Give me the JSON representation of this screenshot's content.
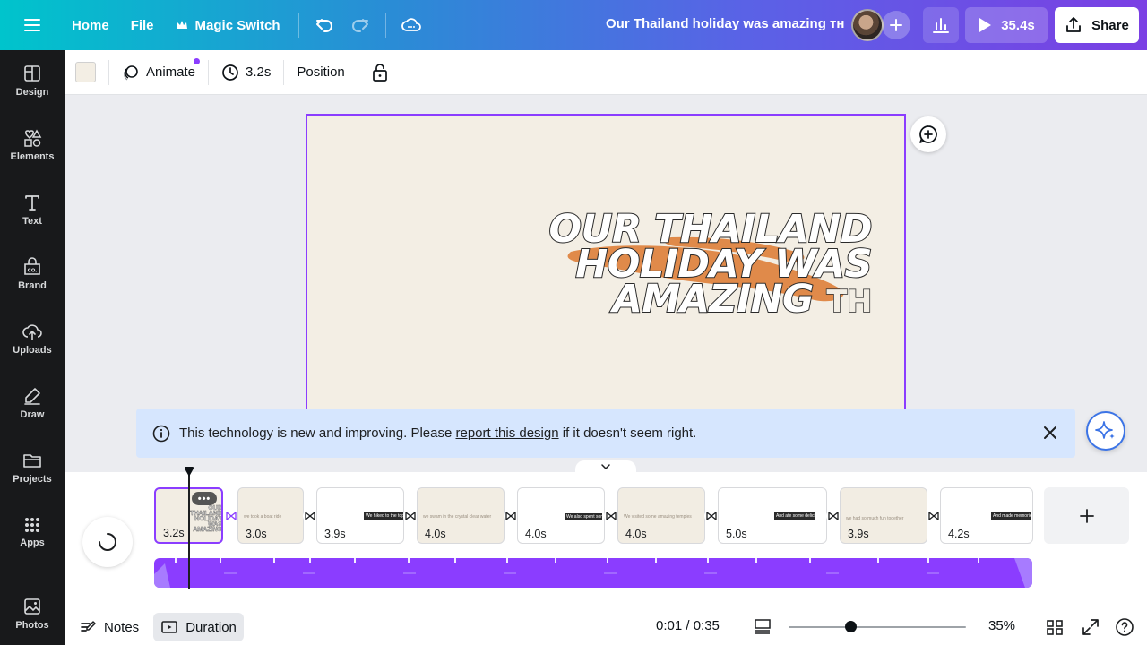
{
  "topbar": {
    "home": "Home",
    "file": "File",
    "magic_switch": "Magic Switch",
    "doc_title": "Our Thailand holiday was amazing ᴛʜ",
    "play_duration": "35.4s",
    "share": "Share"
  },
  "sidebar": {
    "items": [
      {
        "label": "Design",
        "icon": "design-icon"
      },
      {
        "label": "Elements",
        "icon": "elements-icon"
      },
      {
        "label": "Text",
        "icon": "text-icon"
      },
      {
        "label": "Brand",
        "icon": "brand-icon"
      },
      {
        "label": "Uploads",
        "icon": "uploads-icon"
      },
      {
        "label": "Draw",
        "icon": "draw-icon"
      },
      {
        "label": "Projects",
        "icon": "projects-icon"
      },
      {
        "label": "Apps",
        "icon": "apps-icon"
      },
      {
        "label": "Photos",
        "icon": "photos-icon"
      }
    ]
  },
  "toolbar": {
    "background_color": "#f3eee4",
    "animate": "Animate",
    "duration": "3.2s",
    "position": "Position"
  },
  "canvas": {
    "line1": "OUR THAILAND",
    "line2": "HOLIDAY WAS",
    "line3": "AMAZING",
    "suffix": "TH",
    "swoosh_color": "#e08a4a"
  },
  "notice": {
    "before": "This technology is new and improving. Please ",
    "link": "report this design",
    "after": " if it doesn't seem right."
  },
  "timeline": {
    "clips": [
      {
        "duration": "3.2s",
        "caption": "OUR THAILAND HOLIDAY WAS AMAZING",
        "active": true
      },
      {
        "duration": "3.0s",
        "caption": "we took a boat ride",
        "active": false
      },
      {
        "duration": "3.9s",
        "caption": "We hiked to the top of the mountain",
        "active": false
      },
      {
        "duration": "4.0s",
        "caption": "we swam in the crystal clear water",
        "active": false
      },
      {
        "duration": "4.0s",
        "caption": "We also spent some time at the market",
        "active": false
      },
      {
        "duration": "4.0s",
        "caption": "We visited some amazing temples",
        "active": false
      },
      {
        "duration": "5.0s",
        "caption": "And ate some delicious food",
        "active": false
      },
      {
        "duration": "3.9s",
        "caption": "we had so much fun together",
        "active": false
      },
      {
        "duration": "4.2s",
        "caption": "And made memories that will last a lifetime",
        "active": false
      }
    ],
    "clip_menu": "•••"
  },
  "footer": {
    "notes": "Notes",
    "duration": "Duration",
    "time": "0:01 / 0:35",
    "zoom": "35%",
    "zoom_level": 0.35
  },
  "colors": {
    "accent": "#8b3dff",
    "notice_bg": "#d6e6fe"
  }
}
